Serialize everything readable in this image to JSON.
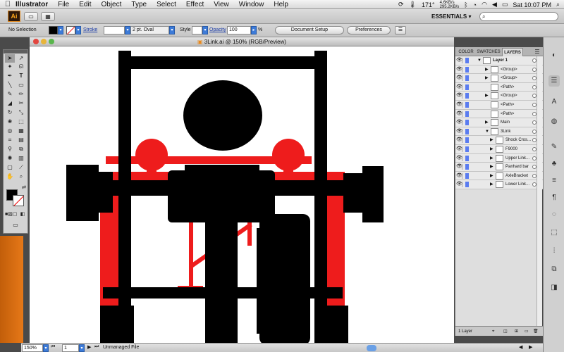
{
  "menubar": {
    "apple": "",
    "app": "Illustrator",
    "items": [
      "File",
      "Edit",
      "Object",
      "Type",
      "Select",
      "Effect",
      "View",
      "Window",
      "Help"
    ],
    "angle": "171°",
    "net_up": "4.6KB/s",
    "net_down": "295.2KB/s",
    "clock": "Sat 10:07 PM"
  },
  "appbar": {
    "logo": "Ai",
    "workspace": "ESSENTIALS ▾",
    "search_placeholder": ""
  },
  "controlbar": {
    "selection": "No Selection",
    "stroke_label": "Stroke",
    "brush_value": "2 pt. Oval",
    "style_label": "Style",
    "opacity_label": "Opacity",
    "opacity_value": "100",
    "opacity_unit": "%",
    "doc_setup": "Document Setup",
    "preferences": "Preferences"
  },
  "document": {
    "title": "3Link.ai @ 150% (RGB/Preview)"
  },
  "panel": {
    "tabs": [
      "COLOR",
      "SWATCHES",
      "LAYERS"
    ],
    "layers": [
      {
        "name": "Layer 1",
        "level": 0,
        "expanded": true
      },
      {
        "name": "<Group>",
        "level": 1
      },
      {
        "name": "<Group>",
        "level": 1
      },
      {
        "name": "<Path>",
        "level": 1
      },
      {
        "name": "<Group>",
        "level": 1
      },
      {
        "name": "<Path>",
        "level": 1
      },
      {
        "name": "<Path>",
        "level": 1
      },
      {
        "name": "Main",
        "level": 1
      },
      {
        "name": "3Link",
        "level": 1,
        "expanded": true
      },
      {
        "name": "Shock Cros...",
        "level": 2
      },
      {
        "name": "F9000",
        "level": 2
      },
      {
        "name": "Upper Link...",
        "level": 2
      },
      {
        "name": "Panhard bar",
        "level": 2
      },
      {
        "name": "AxleBracket",
        "level": 2
      },
      {
        "name": "Lower Link...",
        "level": 2
      }
    ],
    "footer": "1 Layer"
  },
  "status": {
    "zoom": "150%",
    "artboard": "1",
    "file_state": "Unmanaged File"
  },
  "colors": {
    "red": "#ee1c1c",
    "black": "#000000",
    "selection_blue": "#5a7cf0"
  }
}
